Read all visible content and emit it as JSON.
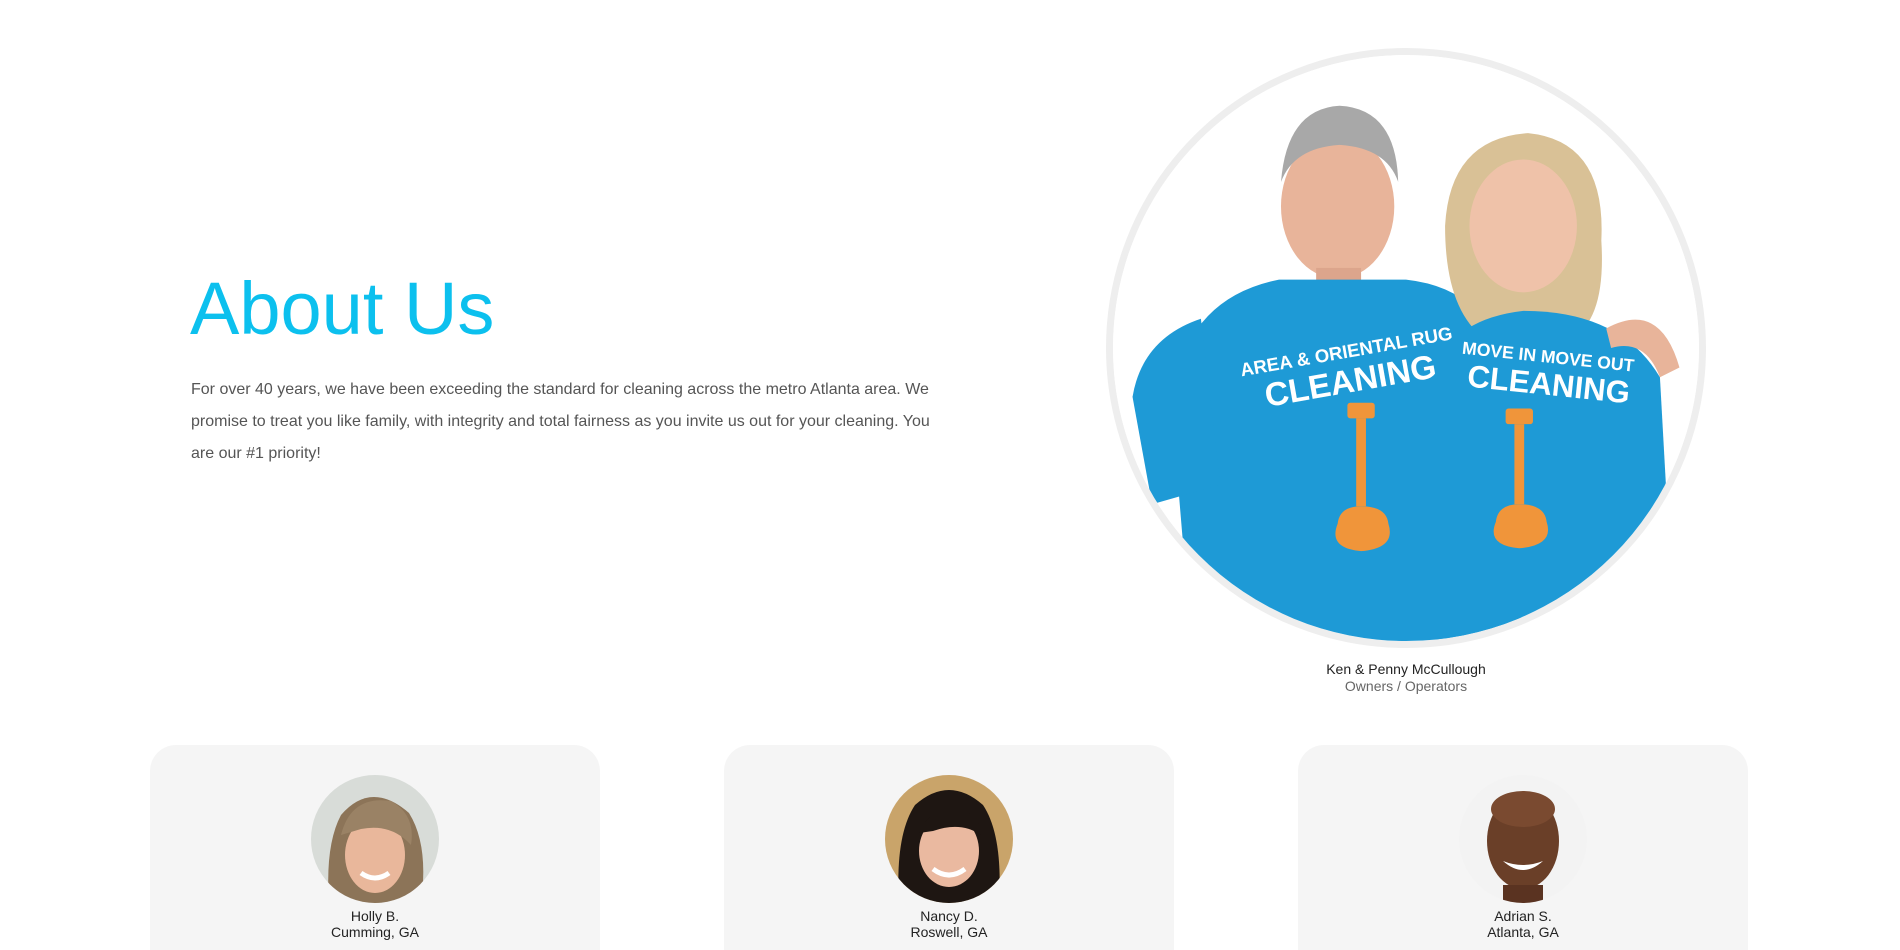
{
  "about": {
    "title": "About Us",
    "paragraph": "For over 40 years, we have been exceeding the standard for cleaning across the metro Atlanta area. We promise to treat you like family, with integrity and total fairness as you invite us out for your cleaning. You are our #1 priority!"
  },
  "owners": {
    "name": "Ken & Penny McCullough",
    "role": "Owners / Operators",
    "shirt_left_line1": "AREA & ORIENTAL RUG",
    "shirt_left_line2": "CLEANING",
    "shirt_right_line1": "MOVE IN MOVE OUT",
    "shirt_right_line2": "CLEANING"
  },
  "team": [
    {
      "name": "Holly B.",
      "location": "Cumming, GA"
    },
    {
      "name": "Nancy D.",
      "location": "Roswell, GA"
    },
    {
      "name": "Adrian S.",
      "location": "Atlanta, GA"
    }
  ],
  "colors": {
    "accent": "#0cc0ee",
    "card_bg": "#f5f5f5",
    "shirt_blue": "#1e9ad6",
    "logo_orange": "#f0953a"
  }
}
